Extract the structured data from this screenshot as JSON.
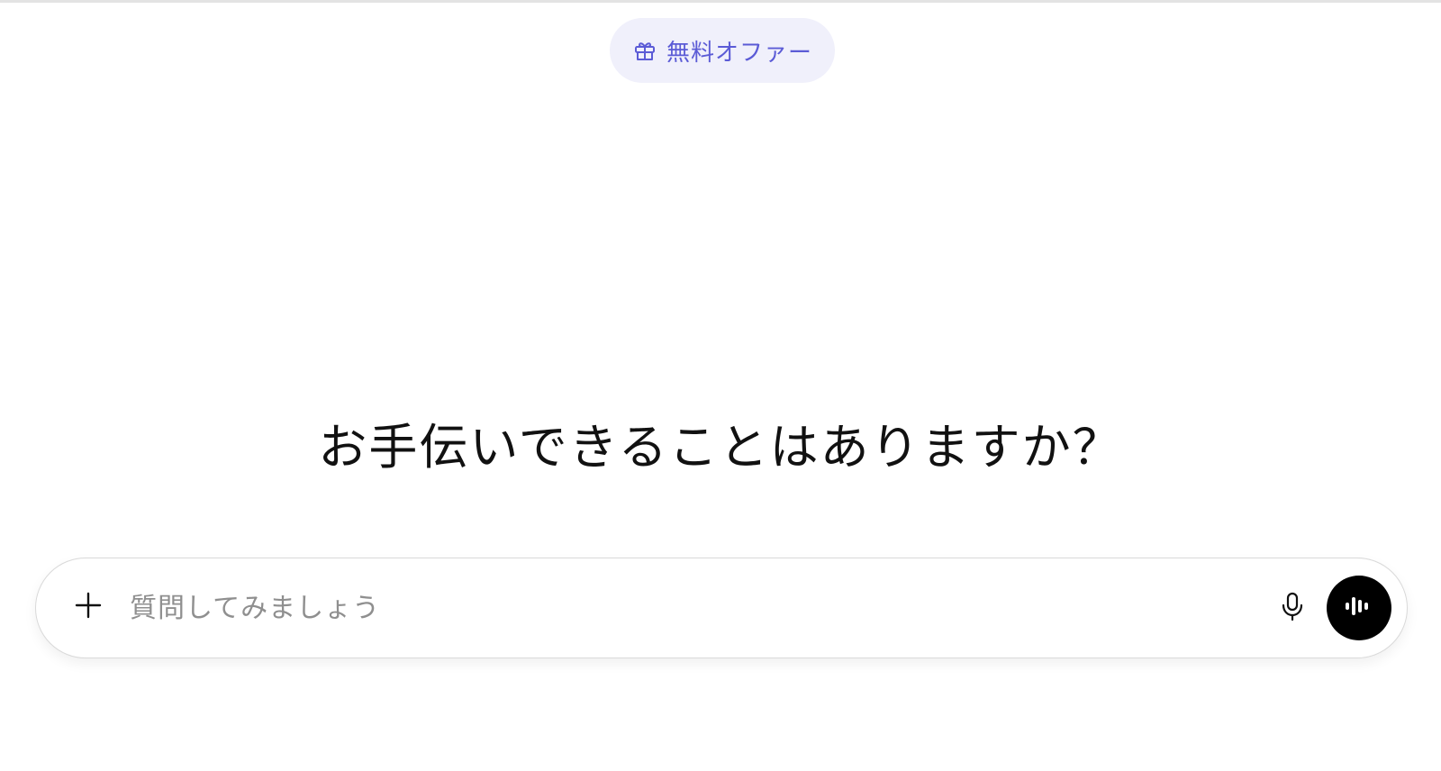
{
  "header": {
    "offer_icon": "gift-icon",
    "offer_label": "無料オファー",
    "offer_color": "#5b5bd6",
    "offer_background": "#f0f0fb"
  },
  "main": {
    "greeting": "お手伝いできることはありますか？"
  },
  "composer": {
    "placeholder": "質問してみましょう",
    "value": "",
    "add_icon": "plus-icon",
    "mic_icon": "microphone-icon",
    "voice_icon": "voice-waveform-icon",
    "voice_button_color": "#000000"
  }
}
